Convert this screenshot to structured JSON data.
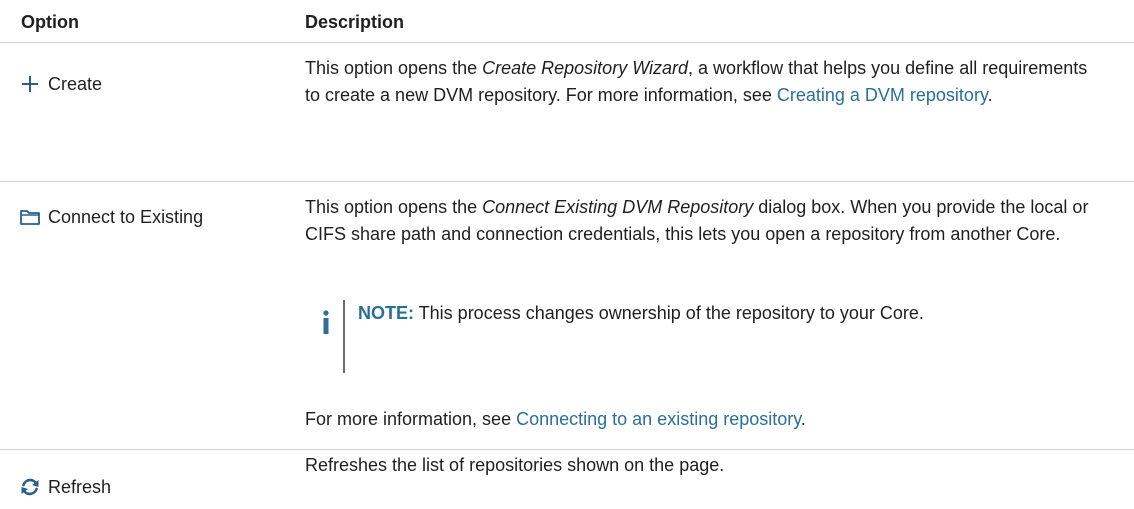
{
  "header": {
    "option": "Option",
    "description": "Description"
  },
  "rows": [
    {
      "icon": "plus-icon",
      "option": "Create",
      "desc_pre": "This option opens the ",
      "desc_em": "Create Repository Wizard",
      "desc_post": ", a workflow that helps you define all requirements to create a new DVM repository. For more information, see ",
      "desc_link": "Creating a DVM repository",
      "desc_end": "."
    },
    {
      "icon": "folder-icon",
      "option": "Connect to Existing",
      "desc_pre": "This option opens the ",
      "desc_em": "Connect Existing DVM Repository",
      "desc_post": " dialog box. When you provide the local or CIFS share path and connection credentials, this lets you open a repository from another Core.",
      "note_label": "NOTE:",
      "note_text": " This process changes ownership of the repository to your Core.",
      "more_pre": "For more information, see ",
      "more_link": "Connecting to an existing repository",
      "more_end": "."
    },
    {
      "icon": "refresh-icon",
      "option": "Refresh",
      "desc": "Refreshes the list of repositories shown on the page."
    }
  ],
  "colors": {
    "link": "#2a6f97",
    "icon": "#2a5d8f",
    "divider": "#cfcfcf"
  }
}
